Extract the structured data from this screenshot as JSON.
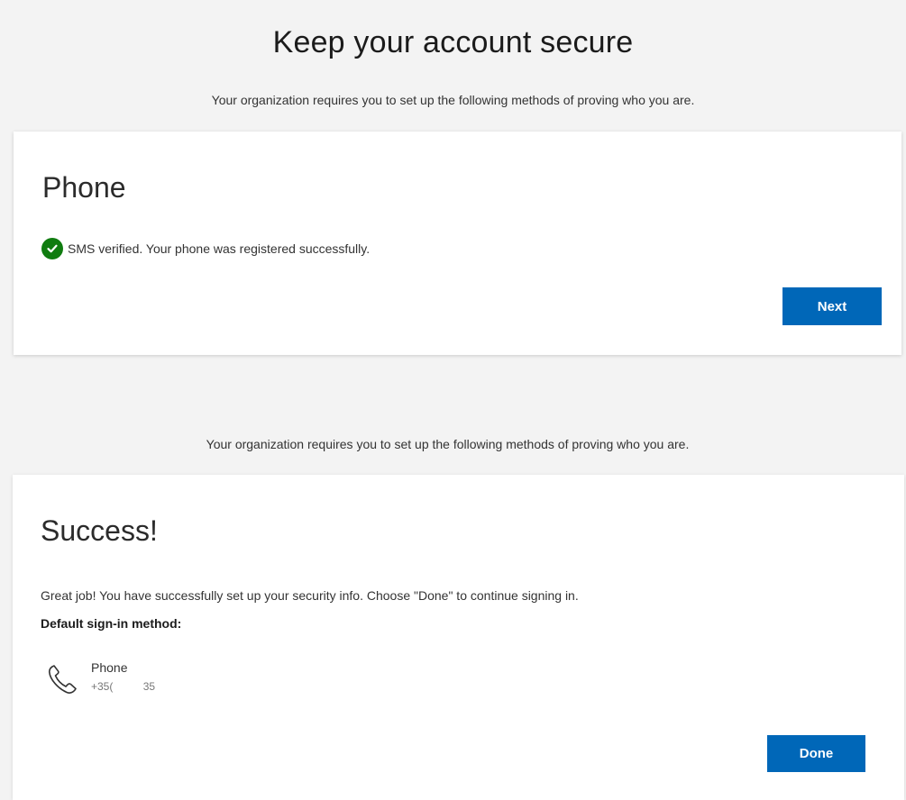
{
  "header": {
    "title": "Keep your account secure",
    "subtitle": "Your organization requires you to set up the following methods of proving who you are."
  },
  "phone_card": {
    "heading": "Phone",
    "status_icon": "check-circle-icon",
    "status_color": "#107c10",
    "status_text": "SMS verified. Your phone was registered successfully.",
    "next_label": "Next"
  },
  "second_subtitle": "Your organization requires you to set up the following methods of proving who you are.",
  "success_card": {
    "heading": "Success!",
    "message": "Great job! You have successfully set up your security info. Choose \"Done\" to continue signing in.",
    "default_label": "Default sign-in method:",
    "method": {
      "icon": "phone-icon",
      "name": "Phone",
      "number": "+35(          35"
    },
    "done_label": "Done"
  },
  "colors": {
    "accent": "#0067b8",
    "background": "#f3f3f3",
    "success": "#107c10"
  }
}
